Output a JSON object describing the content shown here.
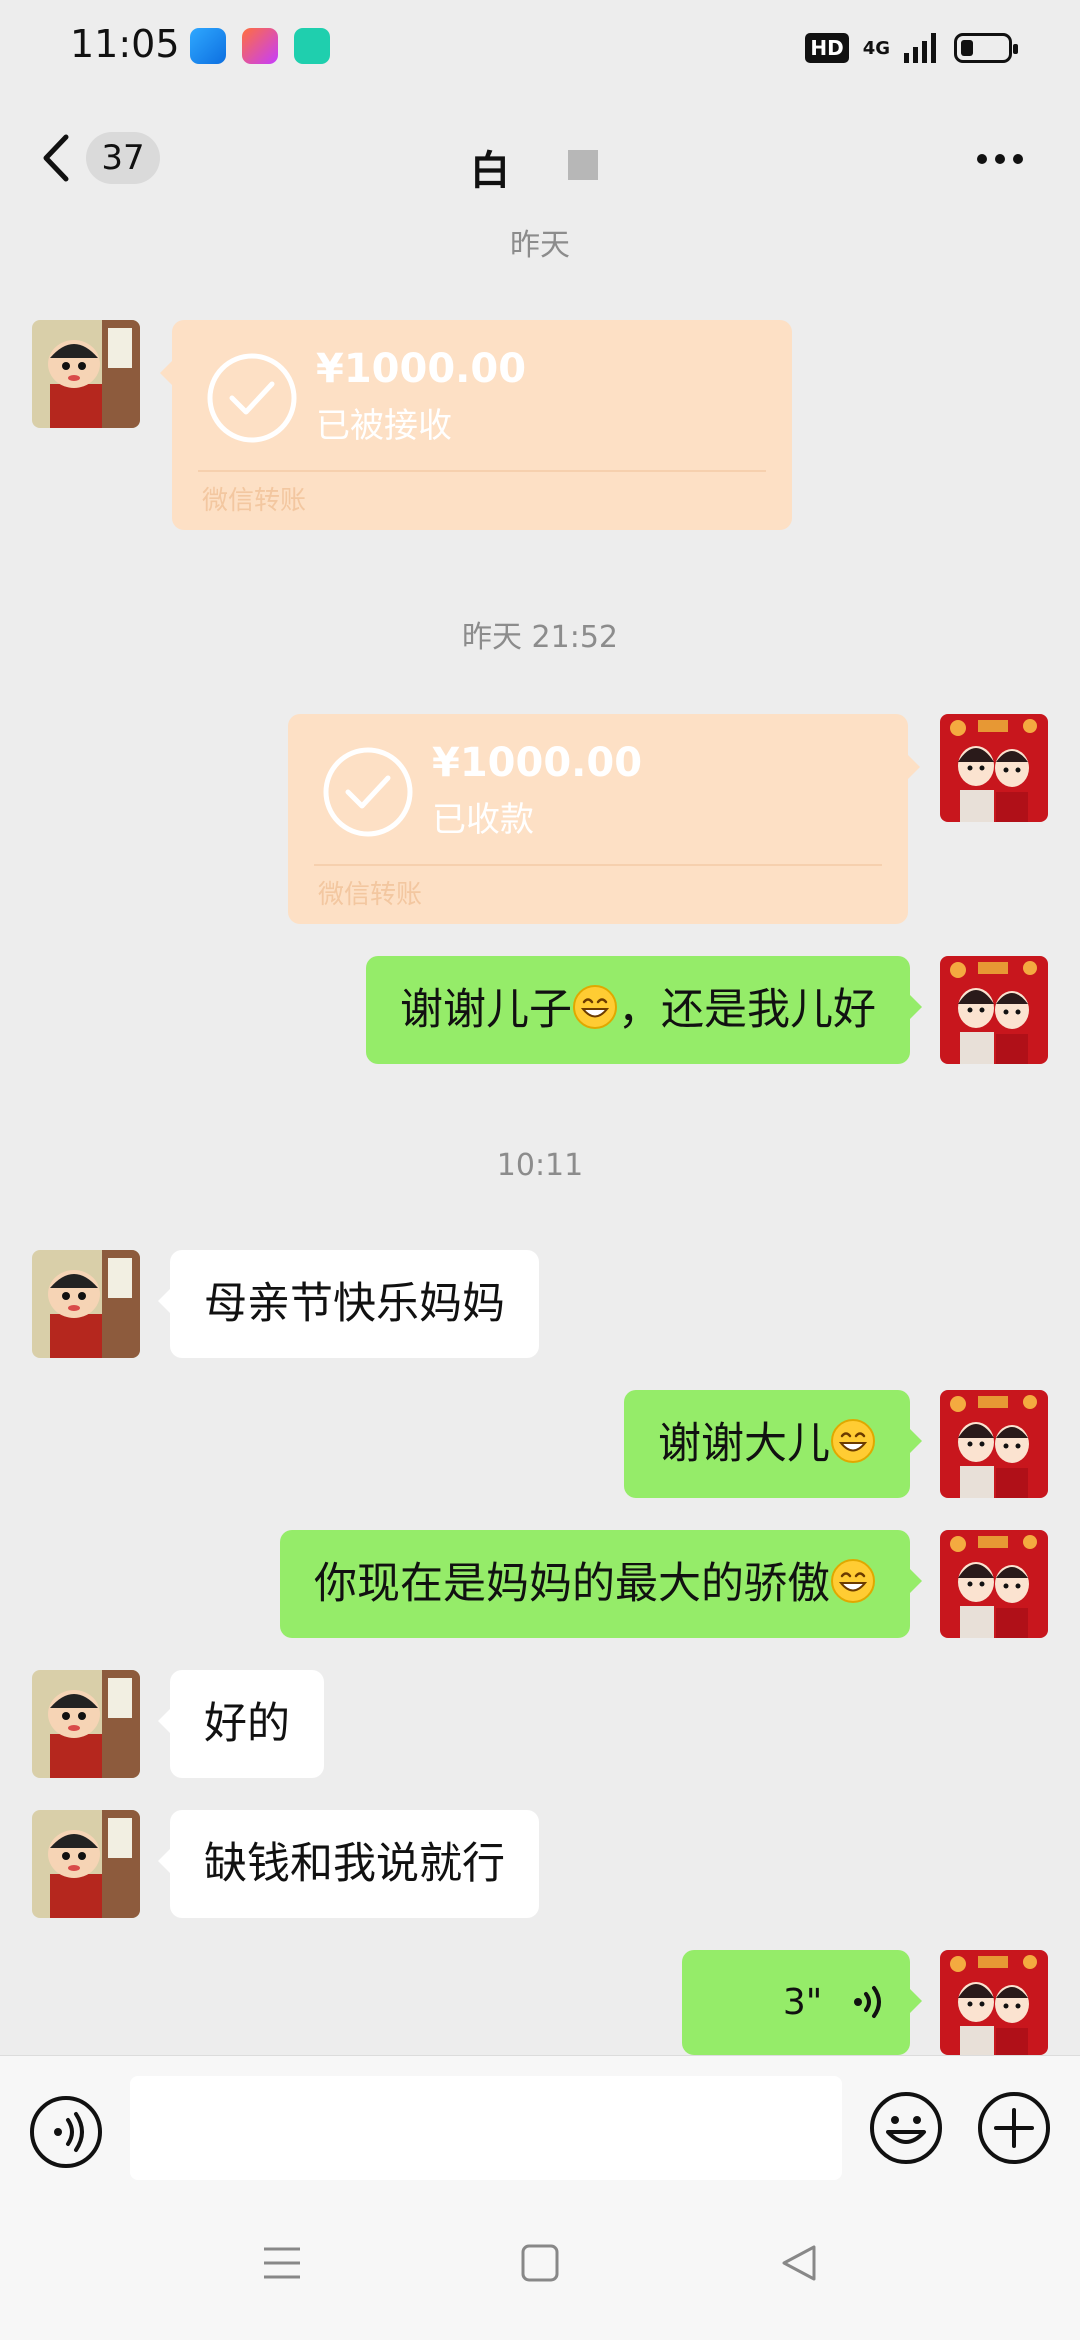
{
  "status_bar": {
    "time": "11:05",
    "hd": "HD",
    "network": "4G",
    "battery_level": 0.25
  },
  "nav": {
    "unread_count": "37",
    "title": "白"
  },
  "messages": {
    "ts_top": "昨天",
    "transfer_left": {
      "amount": "¥1000.00",
      "status": "已被接收",
      "footer": "微信转账"
    },
    "ts_2": "昨天 21:52",
    "transfer_right": {
      "amount": "¥1000.00",
      "status": "已收款",
      "footer": "微信转账"
    },
    "m1": {
      "text": "谢谢儿子",
      "suffix": "，还是我儿好"
    },
    "ts_3": "10:11",
    "m2": {
      "text": "母亲节快乐妈妈"
    },
    "m3": {
      "text": "谢谢大儿"
    },
    "m4": {
      "text": "你现在是妈妈的最大的骄傲"
    },
    "m5": {
      "text": "好的"
    },
    "m6": {
      "text": "缺钱和我说就行"
    },
    "voice": {
      "duration": "3\""
    }
  },
  "input": {
    "placeholder": ""
  },
  "colors": {
    "background": "#ededed",
    "bubble_green": "#95ec69",
    "bubble_white": "#ffffff",
    "transfer_bg": "#fde0c5"
  },
  "icons": [
    "back-icon",
    "more-icon",
    "check-circle-icon",
    "grin-emoji-icon",
    "voice-wave-icon",
    "voice-toggle-icon",
    "emoji-icon",
    "plus-icon",
    "menu-icon",
    "home-icon",
    "back-triangle-icon"
  ]
}
